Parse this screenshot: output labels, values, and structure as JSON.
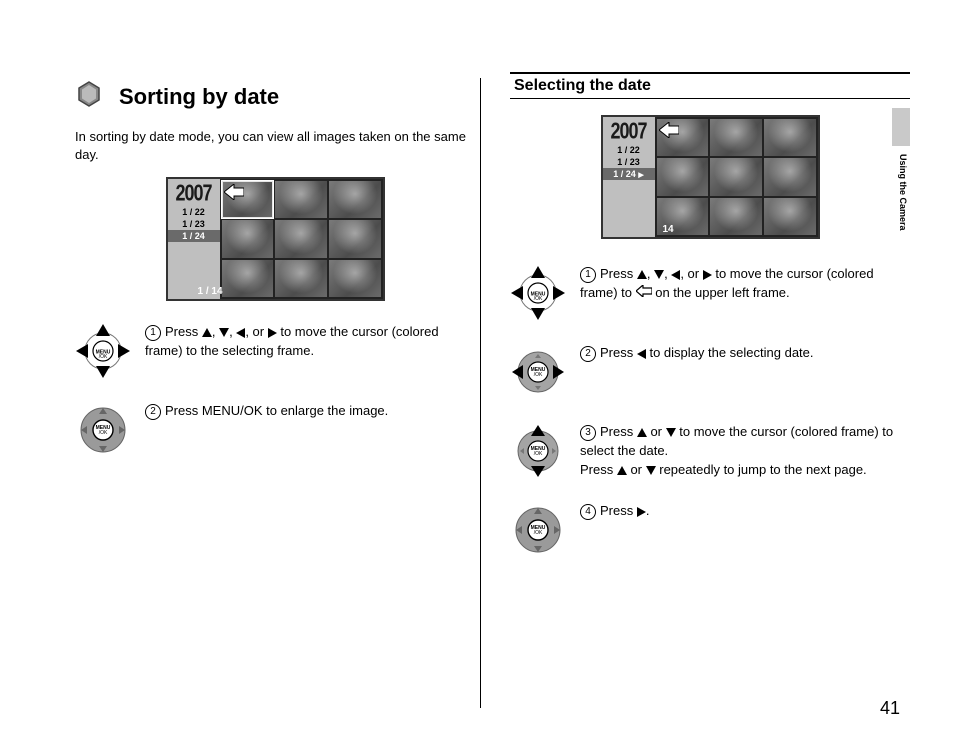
{
  "page_number": "41",
  "side_label": "Using the Camera",
  "left": {
    "title": "Sorting by date",
    "intro": "In sorting by date mode, you can view all images taken on the same day.",
    "lcd": {
      "year": "2007",
      "dates": [
        "1 / 22",
        "1 / 23",
        "1 / 24"
      ],
      "selected_index": 2,
      "counter": "1 / 14"
    },
    "steps": [
      {
        "n": "1",
        "pre": "Press ",
        "post": " to move the cursor (colored frame) to the selecting frame.",
        "arrows": "udlr_or",
        "pad": "full"
      },
      {
        "n": "2",
        "pre": "Press MENU/OK to enlarge the image.",
        "post": "",
        "arrows": "none",
        "pad": "center"
      }
    ]
  },
  "right": {
    "title": "Selecting the date",
    "lcd": {
      "year": "2007",
      "dates": [
        "1 / 22",
        "1 / 23",
        "1 / 24"
      ],
      "selected_index": 2,
      "counter": "14"
    },
    "steps": [
      {
        "n": "1",
        "pre": "Press ",
        "mid": " to move the cursor (colored frame) to ",
        "post": " on the upper left frame.",
        "arrows": "udlr_or",
        "pad": "full",
        "has_outline_arrow": true
      },
      {
        "n": "2",
        "pre": "Press ",
        "post": " to display the selecting date.",
        "arrows": "l",
        "pad": "lr"
      },
      {
        "n": "3",
        "pre": "Press ",
        "mid": " to move the cursor (colored frame) to select the date.",
        "line2a": "Press ",
        "line2b": " repeatedly to jump to the next page.",
        "arrows": "u_or_d",
        "pad": "ud"
      },
      {
        "n": "4",
        "pre": "Press ",
        "post": ".",
        "arrows": "r",
        "pad": "center"
      }
    ]
  }
}
